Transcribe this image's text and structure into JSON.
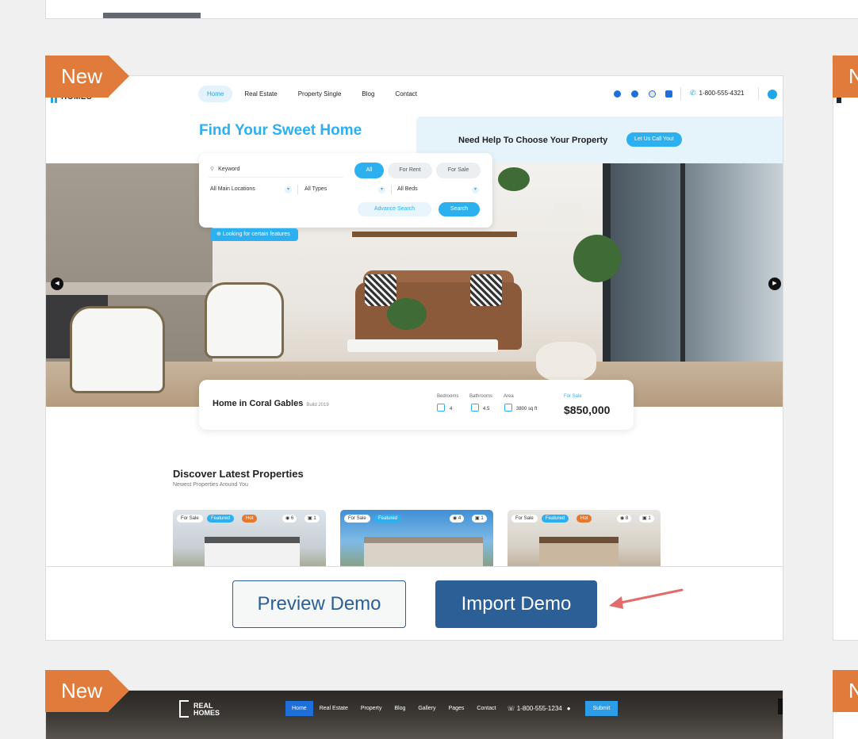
{
  "cards": {
    "badge_label": "New"
  },
  "site": {
    "logo_text": "HOMES",
    "nav": [
      "Home",
      "Real Estate",
      "Property Single",
      "Blog",
      "Contact"
    ],
    "phone": "1-800-555-4321",
    "hero_title": "Find Your Sweet Home",
    "help_text": "Need Help To Choose Your Property",
    "help_button": "Let Us Call You!",
    "search": {
      "keyword_placeholder": "Keyword",
      "tabs": [
        "All",
        "For Rent",
        "For Sale"
      ],
      "locations": "All Main Locations",
      "types": "All Types",
      "beds": "All Beds",
      "advance": "Advance Search",
      "submit": "Search",
      "looking": "Looking for certain features"
    },
    "listing": {
      "title": "Home in Coral Gables",
      "subtitle": "Build 2019",
      "bedrooms_label": "Bedrooms",
      "bedrooms_value": "4",
      "bathrooms_label": "Bathrooms",
      "bathrooms_value": "4.5",
      "area_label": "Area",
      "area_value": "3800 sq ft",
      "status": "For Sale",
      "price": "$850,000"
    },
    "discover": {
      "title": "Discover Latest Properties",
      "subtitle": "Newest Properties Around You",
      "properties": [
        {
          "tags": [
            "For Sale",
            "Featured",
            "Hot"
          ],
          "photos": "6",
          "videos": "1"
        },
        {
          "tags": [
            "For Sale",
            "Featured"
          ],
          "photos": "4",
          "videos": "1"
        },
        {
          "tags": [
            "For Sale",
            "Featured",
            "Hot"
          ],
          "photos": "8",
          "videos": "1"
        }
      ]
    }
  },
  "actions": {
    "preview": "Preview Demo",
    "import": "Import Demo"
  },
  "second_site": {
    "logo_line1": "REAL",
    "logo_line2": "HOMES",
    "nav": [
      "Home",
      "Real Estate",
      "Property",
      "Blog",
      "Gallery",
      "Pages",
      "Contact"
    ],
    "phone": "1-800-555-1234",
    "submit": "Submit"
  },
  "colors": {
    "badge": "#e07b3c",
    "primary_button": "#2c5f95",
    "accent": "#2db0ef",
    "arrow": "#e36b6b"
  }
}
